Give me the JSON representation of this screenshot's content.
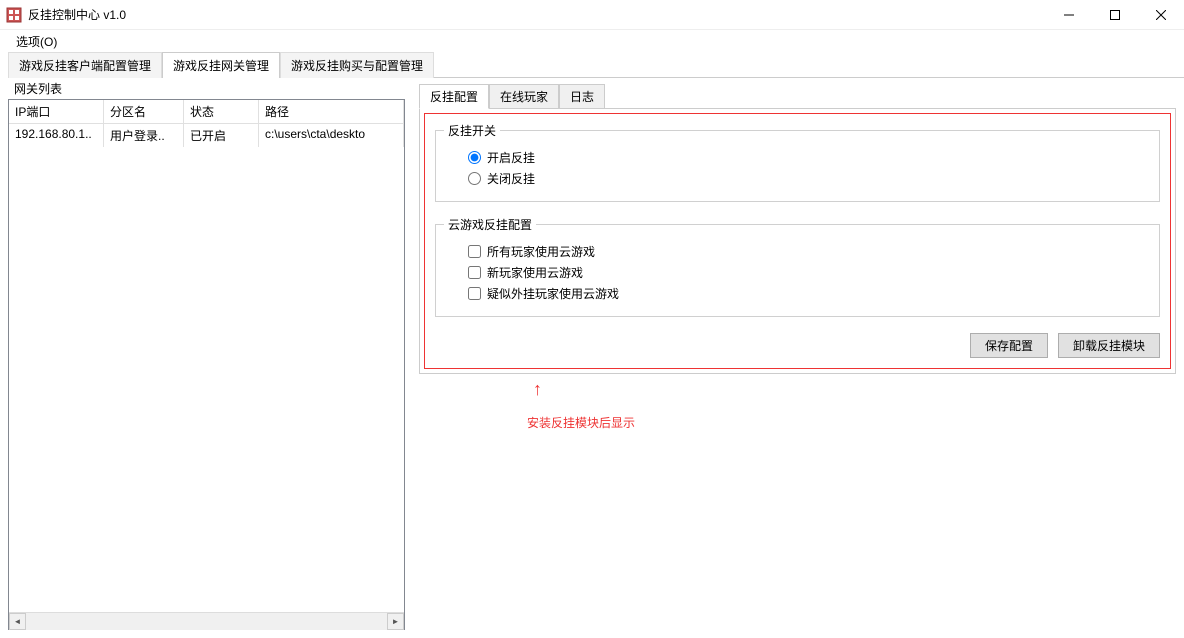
{
  "window": {
    "title": "反挂控制中心 v1.0"
  },
  "menu": {
    "options": "选项(O)"
  },
  "outer_tabs": {
    "items": [
      {
        "label": "游戏反挂客户端配置管理",
        "active": false
      },
      {
        "label": "游戏反挂网关管理",
        "active": true
      },
      {
        "label": "游戏反挂购买与配置管理",
        "active": false
      }
    ]
  },
  "gateway": {
    "list_label": "网关列表",
    "columns": {
      "ip": "IP端口",
      "zone": "分区名",
      "status": "状态",
      "path": "路径"
    },
    "rows": [
      {
        "ip": "192.168.80.1..",
        "zone": "用户登录..",
        "status": "已开启",
        "path": "c:\\users\\cta\\deskto"
      }
    ]
  },
  "inner_tabs": {
    "items": [
      {
        "label": "反挂配置",
        "active": true
      },
      {
        "label": "在线玩家",
        "active": false
      },
      {
        "label": "日志",
        "active": false
      }
    ]
  },
  "config": {
    "switch_group": "反挂开关",
    "radio_on": "开启反挂",
    "radio_off": "关闭反挂",
    "cloud_group": "云游戏反挂配置",
    "check_all": "所有玩家使用云游戏",
    "check_new": "新玩家使用云游戏",
    "check_suspect": "疑似外挂玩家使用云游戏",
    "btn_save": "保存配置",
    "btn_unload": "卸载反挂模块"
  },
  "annotation": {
    "text": "安装反挂模块后显示"
  }
}
